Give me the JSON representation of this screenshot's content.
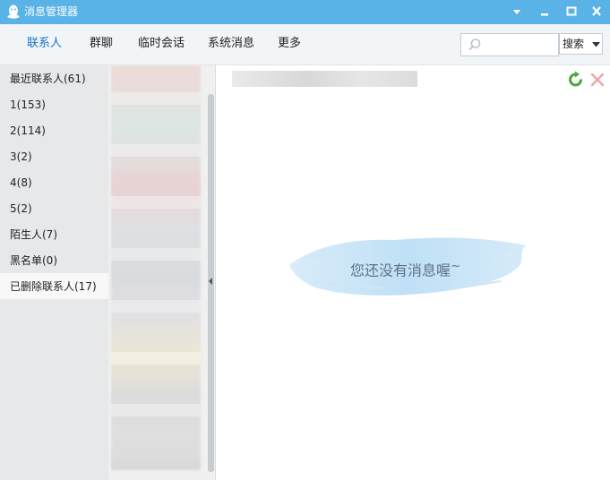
{
  "window": {
    "title": "消息管理器",
    "icons": [
      "qq-penguin-icon",
      "dropdown-arrow-icon",
      "minimize-icon",
      "maximize-icon",
      "close-icon"
    ],
    "title_bar_color": "#59b3e6"
  },
  "tabs": [
    {
      "label": "联系人",
      "active": true
    },
    {
      "label": "群聊",
      "active": false
    },
    {
      "label": "临时会话",
      "active": false
    },
    {
      "label": "系统消息",
      "active": false
    },
    {
      "label": "更多",
      "active": false
    }
  ],
  "search": {
    "placeholder": "",
    "value": "",
    "button_label": "搜索",
    "icon": "search-icon"
  },
  "groups": [
    {
      "label": "最近联系人(61)",
      "selected": false
    },
    {
      "label": "1(153)",
      "selected": false
    },
    {
      "label": "2(114)",
      "selected": false
    },
    {
      "label": "3(2)",
      "selected": false
    },
    {
      "label": "4(8)",
      "selected": false
    },
    {
      "label": "5(2)",
      "selected": false
    },
    {
      "label": "陌生人(7)",
      "selected": false
    },
    {
      "label": "黑名单(0)",
      "selected": false
    },
    {
      "label": "已删除联系人(17)",
      "selected": true
    }
  ],
  "message_pane": {
    "empty_text": "您还没有消息喔",
    "empty_suffix": "~",
    "actions": [
      "refresh-icon",
      "delete-icon"
    ]
  },
  "colors": {
    "accent": "#1a73c9",
    "empty_text": "#5d7187",
    "brush": "#bfe0f5"
  }
}
